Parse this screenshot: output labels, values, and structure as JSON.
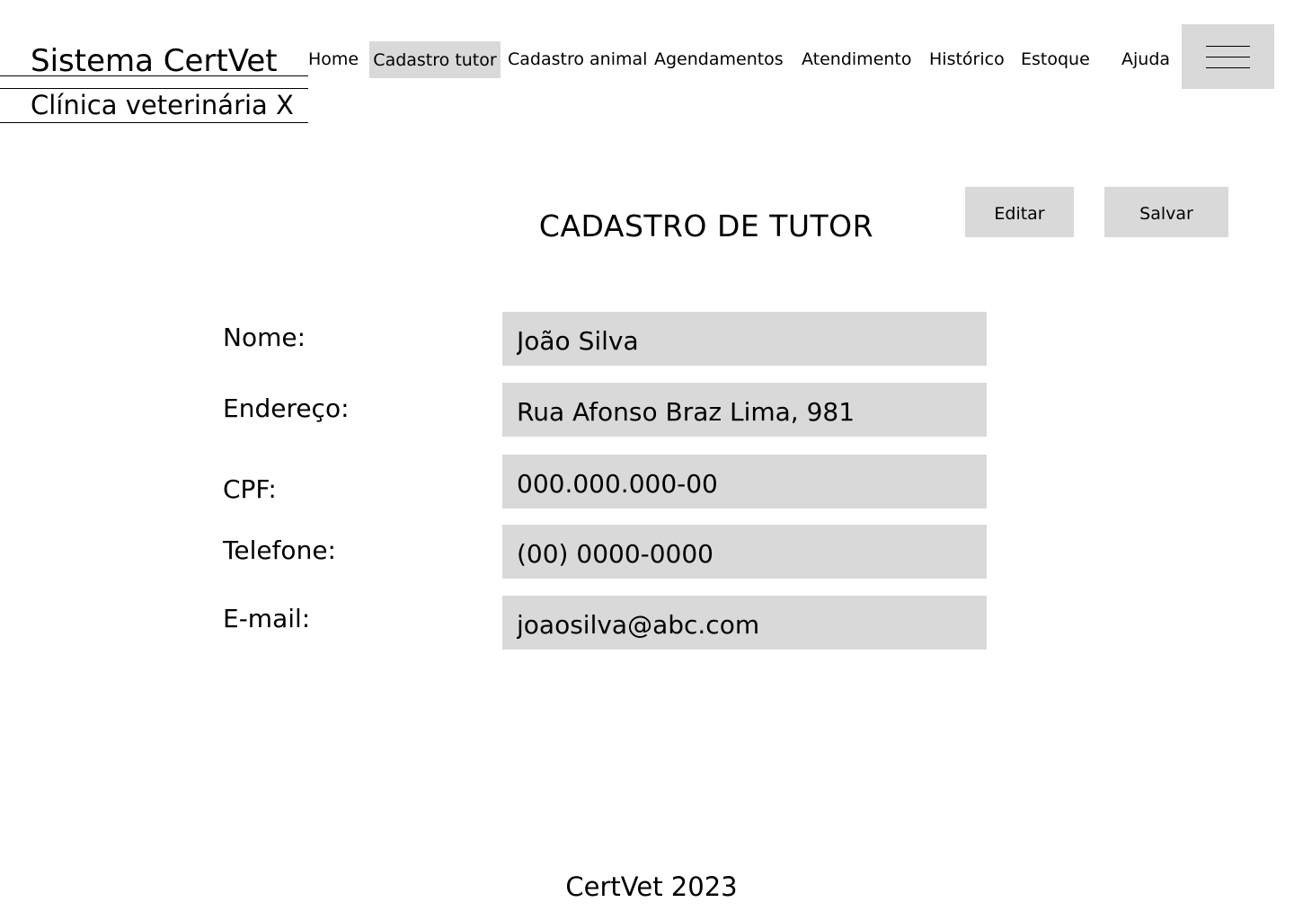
{
  "brand": {
    "title": "Sistema CertVet",
    "subtitle": "Clínica veterinária X"
  },
  "nav": {
    "items": [
      {
        "label": "Home"
      },
      {
        "label": "Cadastro tutor",
        "active": true
      },
      {
        "label": "Cadastro animal"
      },
      {
        "label": "Agendamentos"
      },
      {
        "label": "Atendimento"
      },
      {
        "label": "Histórico"
      },
      {
        "label": "Estoque"
      },
      {
        "label": "Ajuda"
      }
    ],
    "menu_icon": "hamburger-menu-icon"
  },
  "page": {
    "title": "CADASTRO DE TUTOR"
  },
  "actions": {
    "edit_label": "Editar",
    "save_label": "Salvar"
  },
  "form": {
    "fields": [
      {
        "label": "Nome:",
        "value": "João Silva"
      },
      {
        "label": "Endereço:",
        "value": "Rua Afonso Braz Lima, 981"
      },
      {
        "label": "CPF:",
        "value": "000.000.000-00"
      },
      {
        "label": "Telefone:",
        "value": "(00) 0000-0000"
      },
      {
        "label": "E-mail:",
        "value": "joaosilva@abc.com"
      }
    ]
  },
  "footer": {
    "text": "CertVet 2023"
  },
  "colors": {
    "control_background": "#d9d9d9",
    "text": "#000000",
    "page_background": "#ffffff"
  }
}
